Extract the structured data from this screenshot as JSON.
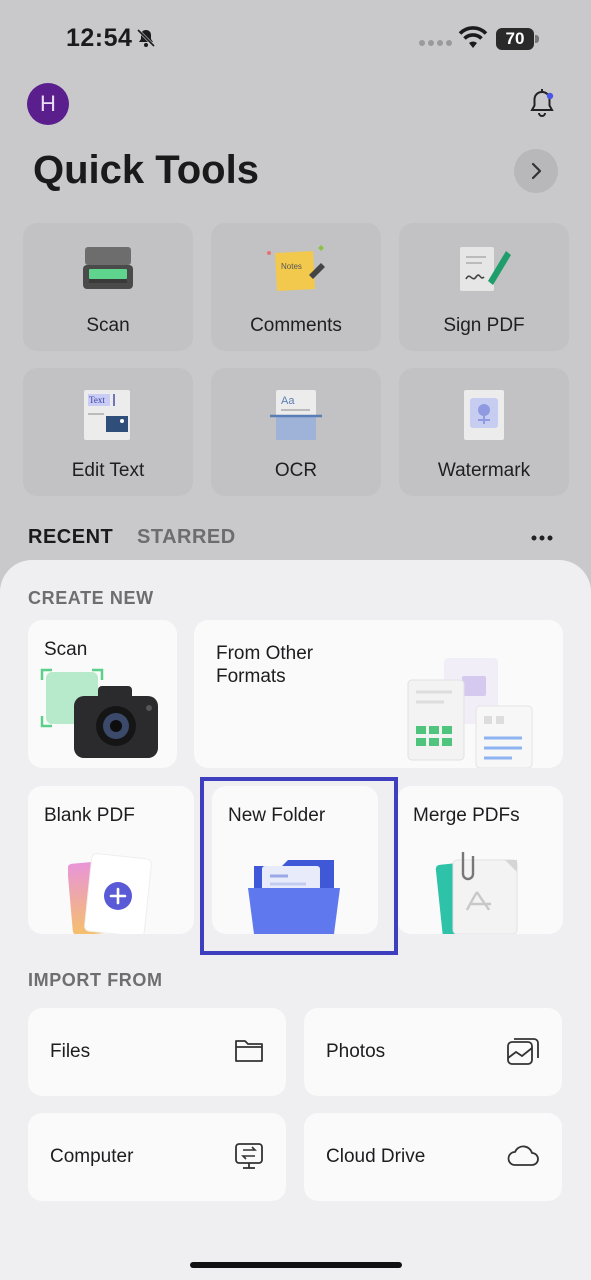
{
  "status_bar": {
    "time": "12:54",
    "battery": "70"
  },
  "header": {
    "avatar_initial": "H",
    "title": "Quick Tools"
  },
  "quick_tools": [
    {
      "label": "Scan",
      "icon": "scanner-icon"
    },
    {
      "label": "Comments",
      "icon": "sticky-note-icon"
    },
    {
      "label": "Sign PDF",
      "icon": "signature-icon"
    },
    {
      "label": "Edit Text",
      "icon": "edit-text-icon"
    },
    {
      "label": "OCR",
      "icon": "ocr-icon"
    },
    {
      "label": "Watermark",
      "icon": "watermark-icon"
    }
  ],
  "tabs": {
    "recent": "RECENT",
    "starred": "STARRED"
  },
  "create_new": {
    "title": "CREATE NEW",
    "scan": "Scan",
    "from_other_formats": "From Other\nFormats",
    "blank_pdf": "Blank PDF",
    "new_folder": "New Folder",
    "merge_pdfs": "Merge PDFs"
  },
  "import_from": {
    "title": "IMPORT FROM",
    "files": "Files",
    "photos": "Photos",
    "computer": "Computer",
    "cloud_drive": "Cloud Drive"
  },
  "colors": {
    "accent": "#4b55e8",
    "highlight": "#3e3fbf",
    "avatar": "#5b1e8d"
  }
}
